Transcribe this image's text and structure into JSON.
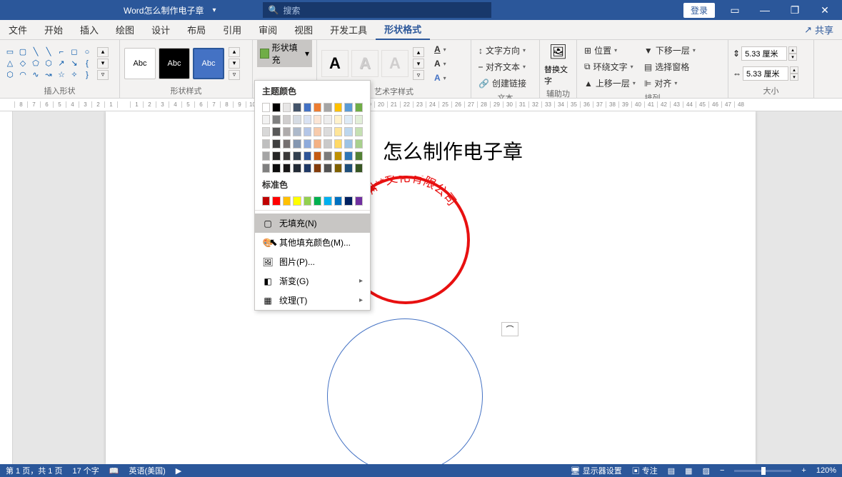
{
  "titlebar": {
    "document_title": "Word怎么制作电子章",
    "search_placeholder": "搜索",
    "login_label": "登录"
  },
  "tabs": {
    "file": "文件",
    "home": "开始",
    "insert": "插入",
    "draw": "绘图",
    "design": "设计",
    "layout": "布局",
    "references": "引用",
    "review": "审阅",
    "view": "视图",
    "developer": "开发工具",
    "shape_format": "形状格式",
    "share": "共享"
  },
  "ribbon": {
    "insert_shapes_label": "插入形状",
    "shape_styles_label": "形状样式",
    "wordart_styles_label": "艺术字样式",
    "text_label": "文本",
    "accessibility_label": "辅助功能",
    "arrange_label": "排列",
    "size_label": "大小",
    "style_abc": "Abc",
    "shape_fill": "形状填充",
    "text_direction": "文字方向",
    "align_text": "对齐文本",
    "create_link": "创建链接",
    "alt_text": "替换文字",
    "position": "位置",
    "wrap_text": "环绕文字",
    "bring_forward": "上移一层",
    "send_backward": "下移一层",
    "selection_pane": "选择窗格",
    "align": "对齐",
    "height_value": "5.33 厘米",
    "width_value": "5.33 厘米"
  },
  "fill_menu": {
    "theme_colors": "主题颜色",
    "standard_colors": "标准色",
    "no_fill": "无填充(N)",
    "more_colors": "其他填充颜色(M)...",
    "picture": "图片(P)...",
    "gradient": "渐变(G)",
    "texture": "纹理(T)",
    "theme_row1": [
      "#ffffff",
      "#000000",
      "#e7e6e6",
      "#44546a",
      "#4472c4",
      "#ed7d31",
      "#a5a5a5",
      "#ffc000",
      "#5b9bd5",
      "#70ad47"
    ],
    "theme_shades": [
      [
        "#f2f2f2",
        "#808080",
        "#d0cece",
        "#d6dce4",
        "#d9e2f3",
        "#fbe5d5",
        "#ededed",
        "#fff2cc",
        "#deebf6",
        "#e2efd9"
      ],
      [
        "#d8d8d8",
        "#595959",
        "#aeabab",
        "#adb9ca",
        "#b4c6e7",
        "#f7cbac",
        "#dbdbdb",
        "#fee599",
        "#bdd7ee",
        "#c5e0b3"
      ],
      [
        "#bfbfbf",
        "#3f3f3f",
        "#757070",
        "#8496b0",
        "#8eaadb",
        "#f4b183",
        "#c9c9c9",
        "#ffd965",
        "#9cc3e5",
        "#a8d08d"
      ],
      [
        "#a5a5a5",
        "#262626",
        "#3a3838",
        "#323f4f",
        "#2f5496",
        "#c55a11",
        "#7b7b7b",
        "#bf9000",
        "#2e75b5",
        "#538135"
      ],
      [
        "#7f7f7f",
        "#0c0c0c",
        "#171616",
        "#222a35",
        "#1f3864",
        "#833c0b",
        "#525252",
        "#7f6000",
        "#1e4e79",
        "#375623"
      ]
    ],
    "standard_row": [
      "#c00000",
      "#ff0000",
      "#ffc000",
      "#ffff00",
      "#92d050",
      "#00b050",
      "#00b0f0",
      "#0070c0",
      "#002060",
      "#7030a0"
    ]
  },
  "document": {
    "heading": "怎么制作电子章",
    "seal_text": "深圳**文化有限公司"
  },
  "statusbar": {
    "page_info": "第 1 页，共 1 页",
    "word_count": "17 个字",
    "language": "英语(美国)",
    "display_settings": "显示器设置",
    "focus": "专注",
    "zoom": "120%"
  }
}
